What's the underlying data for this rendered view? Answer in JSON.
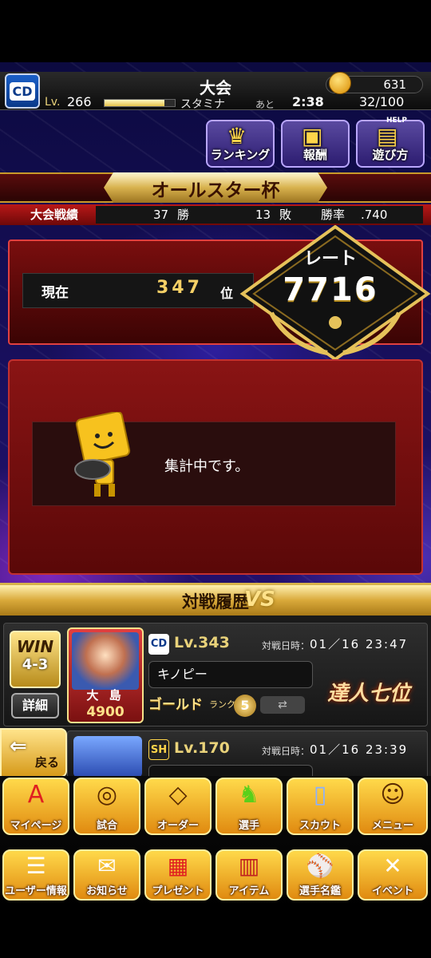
{
  "header": {
    "team_logo": "CD",
    "title": "大会",
    "coins": "631",
    "level_label": "Lv.",
    "level": "266",
    "stamina_label": "スタミナ",
    "stamina_fill": 0.85,
    "remaining_label": "あと",
    "timer": "2:38",
    "stamina_value": "32/100"
  },
  "top_buttons": [
    {
      "label": "ランキング",
      "icon": "crown-icon"
    },
    {
      "label": "報酬",
      "icon": "treasure-chest-icon"
    },
    {
      "label": "遊び方",
      "icon": "help-book-icon",
      "badge": "HELP"
    }
  ],
  "tournament": {
    "name": "オールスター杯",
    "record_label": "大会戦績",
    "wins": "37",
    "wins_unit": "勝",
    "losses": "13",
    "losses_unit": "敗",
    "rate_label": "勝率",
    "win_rate": ".740"
  },
  "rank": {
    "current_label": "現在",
    "position": "347",
    "position_unit": "位",
    "rate_title": "レート",
    "rate_value": "7716"
  },
  "notice": {
    "message": "集計中です。"
  },
  "history": {
    "title": "対戦履歴",
    "vs_label": "VS",
    "row1": {
      "result": "WIN",
      "score": "4-3",
      "detail_label": "詳細",
      "player_name": "大 島",
      "player_power": "4900",
      "team_logo": "CD",
      "level": "Lv.343",
      "datetime_label": "対戦日時：",
      "datetime": "01／16 23:47",
      "opponent_name": "キノピー",
      "rank_label": "ゴールド",
      "rank_small": "ランク",
      "rank_num": "5",
      "title_badge": "達人七位"
    },
    "row2": {
      "team_logo": "SH",
      "level": "Lv.170",
      "datetime_label": "対戦日時：",
      "datetime": "01／16 23:39"
    }
  },
  "back_label": "戻る",
  "nav_row1": [
    {
      "label": "マイページ",
      "icon": "letter-a-icon"
    },
    {
      "label": "試合",
      "icon": "stadium-icon"
    },
    {
      "label": "オーダー",
      "icon": "field-lineup-icon"
    },
    {
      "label": "選手",
      "icon": "batter-icon"
    },
    {
      "label": "スカウト",
      "icon": "scout-card-icon"
    },
    {
      "label": "メニュー",
      "icon": "mascot-icon"
    }
  ],
  "nav_row2": [
    {
      "label": "ユーザー情報",
      "icon": "user-card-icon"
    },
    {
      "label": "お知らせ",
      "icon": "notice-icon"
    },
    {
      "label": "プレゼント",
      "icon": "gift-icon"
    },
    {
      "label": "アイテム",
      "icon": "item-book-icon"
    },
    {
      "label": "選手名鑑",
      "icon": "player-directory-icon"
    },
    {
      "label": "イベント",
      "icon": "bat-ball-icon"
    }
  ]
}
